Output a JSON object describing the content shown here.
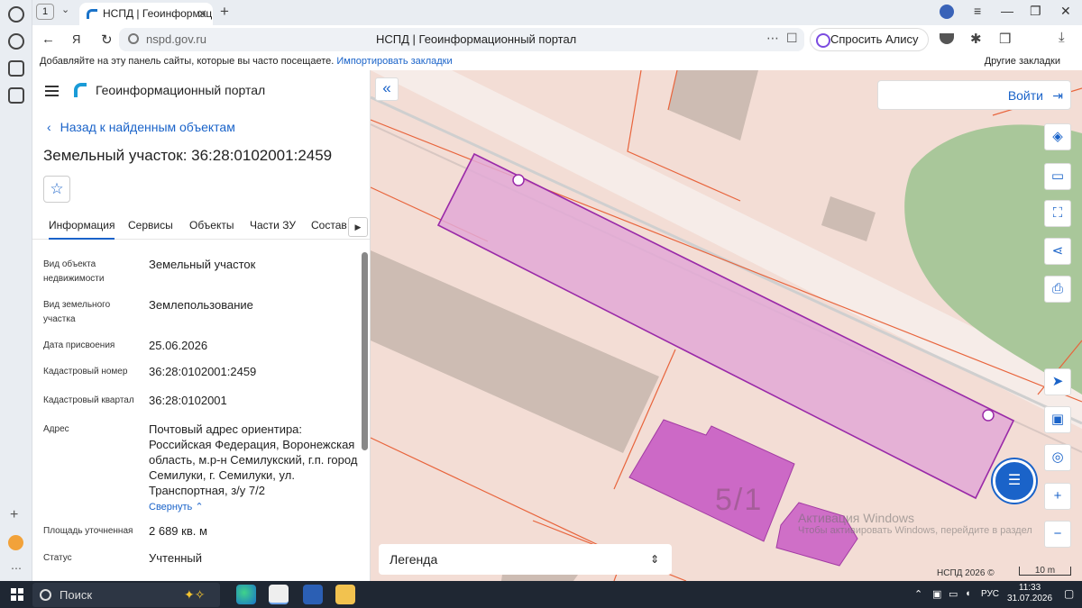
{
  "browser": {
    "tab_count": "1",
    "tab_title": "НСПД | Геоинформационный портал",
    "url": "nspd.gov.ru",
    "page_title": "НСПД | Геоинформационный портал",
    "alice_label": "Спросить Алису AI",
    "bookmarks_text": "Добавляйте на эту панель сайты, которые вы часто посещаете.",
    "bookmarks_link": "Импортировать закладки",
    "other_bookmarks": "Другие закладки"
  },
  "panel": {
    "portal_name": "Геоинформационный портал",
    "back_label": "Назад к найденным объектам",
    "object_title": "Земельный участок: 36:28:0102001:2459",
    "tabs": [
      "Информация",
      "Сервисы",
      "Объекты",
      "Части ЗУ",
      "Состав"
    ],
    "fields": [
      {
        "label": "Вид объекта недвижимости",
        "value": "Земельный участок"
      },
      {
        "label": "Вид земельного участка",
        "value": "Землепользование"
      },
      {
        "label": "Дата присвоения",
        "value": "25.06.2026"
      },
      {
        "label": "Кадастровый номер",
        "value": "36:28:0102001:2459"
      },
      {
        "label": "Кадастровый квартал",
        "value": "36:28:0102001"
      },
      {
        "label": "Адрес",
        "value": "Почтовый адрес ориентира: Российская Федерация, Воронежская область, м.р-н Семилукский, г.п. город Семилуки, г. Семилуки, ул. Транспортная, з/у 7/2"
      },
      {
        "label": "Площадь уточненная",
        "value": "2 689 кв. м"
      },
      {
        "label": "Статус",
        "value": "Учтенный"
      }
    ],
    "collapse_label": "Свернуть"
  },
  "map": {
    "login_label": "Войти",
    "legend_label": "Легенда",
    "copyright": "НСПД 2026 ©",
    "scale_label": "10 m",
    "plot_label": "5/1",
    "watermark_line1": "Активация Windows",
    "watermark_line2": "Чтобы активировать Windows, перейдите в раздел",
    "colors": {
      "parcel_fill": "#e2a9d6",
      "parcel_stroke": "#9a2aa8",
      "building": "#c85cc4",
      "boundary": "#e8643c",
      "greenery": "#a9c79a"
    }
  },
  "taskbar": {
    "search_label": "Поиск",
    "language": "РУС",
    "time": "11:33",
    "date": "31.07.2026"
  }
}
